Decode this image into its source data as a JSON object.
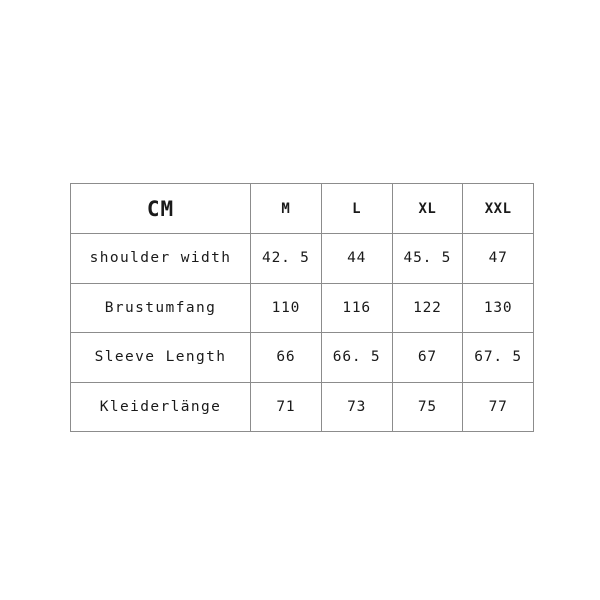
{
  "chart_data": {
    "type": "table",
    "title": "",
    "unit_header": "CM",
    "columns": [
      "CM",
      "M",
      "L",
      "XL",
      "XXL"
    ],
    "size_headers": [
      "M",
      "L",
      "XL",
      "XXL"
    ],
    "row_labels": [
      "shoulder width",
      "Brustumfang",
      "Sleeve Length",
      "Kleiderlänge"
    ],
    "rows": [
      {
        "label": "shoulder width",
        "values": [
          "42. 5",
          "44",
          "45. 5",
          "47"
        ]
      },
      {
        "label": "Brustumfang",
        "values": [
          "110",
          "116",
          "122",
          "130"
        ]
      },
      {
        "label": "Sleeve Length",
        "values": [
          "66",
          "66. 5",
          "67",
          "67. 5"
        ]
      },
      {
        "label": "Kleiderlänge",
        "values": [
          "71",
          "73",
          "75",
          "77"
        ]
      }
    ],
    "numeric_values": {
      "shoulder width": [
        42.5,
        44,
        45.5,
        47
      ],
      "Brustumfang": [
        110,
        116,
        122,
        130
      ],
      "Sleeve Length": [
        66,
        66.5,
        67,
        67.5
      ],
      "Kleiderlänge": [
        71,
        73,
        75,
        77
      ]
    },
    "unit": "CM",
    "grid": true,
    "legend": "none"
  },
  "colors": {
    "background": "#ffffff",
    "grid_line": "#8c8c8c",
    "text": "#1a1a1a"
  }
}
